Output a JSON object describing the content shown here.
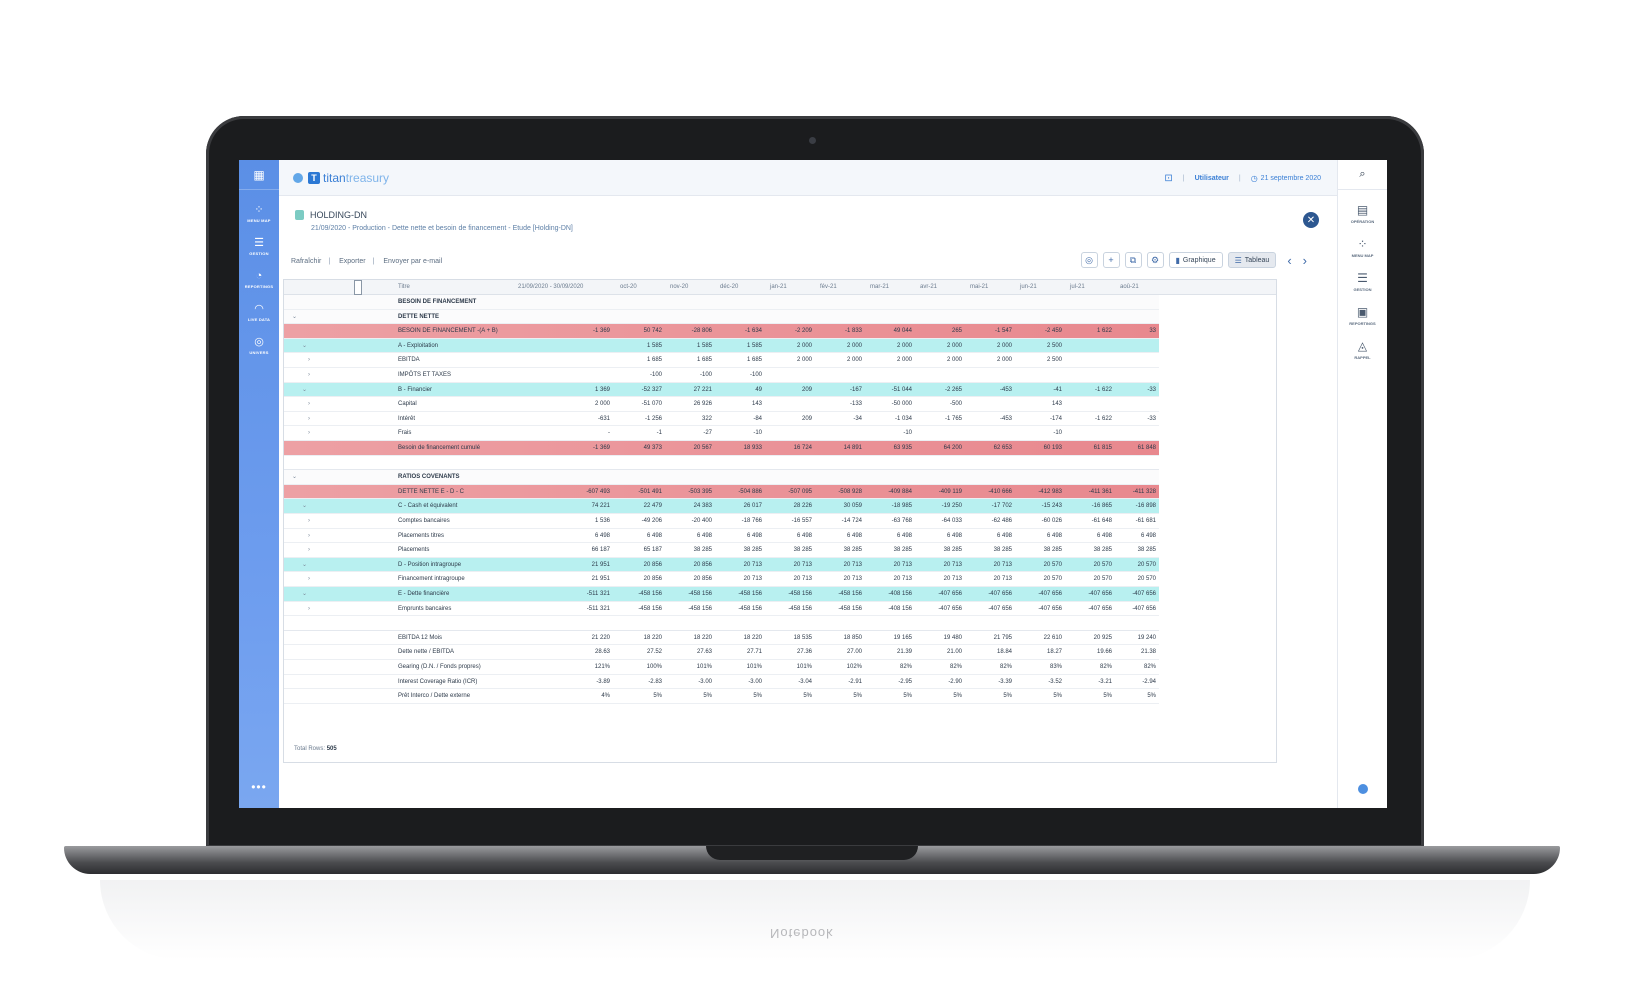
{
  "device_reflection_text": "Notebook",
  "left_sidebar": {
    "top_icon": "calendar-icon",
    "items": [
      {
        "label": "MENU MAP",
        "icon": "grid-icon"
      },
      {
        "label": "GESTION",
        "icon": "list-icon"
      },
      {
        "label": "REPORTINGS",
        "icon": "gauge-icon"
      },
      {
        "label": "LIVE DATA",
        "icon": "rss-icon"
      },
      {
        "label": "UNIVERS",
        "icon": "globe-icon"
      }
    ],
    "more": "•••"
  },
  "header": {
    "logo_word1": "titan",
    "logo_word2": "treasury",
    "user": "Utilisateur",
    "date": "21 septembre 2020"
  },
  "right_sidebar": {
    "items": [
      {
        "label": "OPÉRATION",
        "icon": "document-plus-icon"
      },
      {
        "label": "MENU MAP",
        "icon": "grid-plus-icon"
      },
      {
        "label": "GESTION",
        "icon": "list-plus-icon"
      },
      {
        "label": "REPORTINGS",
        "icon": "report-plus-icon"
      },
      {
        "label": "RAPPEL",
        "icon": "bell-plus-icon"
      }
    ]
  },
  "page": {
    "title": "HOLDING-DN",
    "subtitle": "21/09/2020 - Production - Dette nette et besoin de financement - Etude [Holding-DN]",
    "actions": [
      "Rafraîchir",
      "Exporter",
      "Envoyer par e-mail"
    ],
    "btn_graphique": "Graphique",
    "btn_tableau": "Tableau"
  },
  "table": {
    "columns": [
      "Titre",
      "21/09/2020 - 30/09/2020",
      "oct-20",
      "nov-20",
      "déc-20",
      "jan-21",
      "fév-21",
      "mar-21",
      "avr-21",
      "mai-21",
      "jun-21",
      "jul-21",
      "aoû-21"
    ],
    "rows": [
      {
        "type": "hdrow",
        "caret": "",
        "indent": 0,
        "label": "BESOIN DE FINANCEMENT",
        "values": []
      },
      {
        "type": "hdrow",
        "caret": "v",
        "indent": 0,
        "label": "DETTE NETTE",
        "values": []
      },
      {
        "type": "red",
        "caret": "",
        "indent": 0,
        "label": "BESOIN DE FINANCEMENT -(A + B)",
        "values": [
          "-1 369",
          "50 742",
          "-28 806",
          "-1 634",
          "-2 209",
          "-1 833",
          "49 044",
          "265",
          "-1 547",
          "-2 459",
          "1 622",
          "33"
        ]
      },
      {
        "type": "teal",
        "caret": "v",
        "indent": 1,
        "label": "A - Exploitation",
        "values": [
          "",
          "1 585",
          "1 585",
          "1 585",
          "2 000",
          "2 000",
          "2 000",
          "2 000",
          "2 000",
          "2 500",
          "",
          ""
        ]
      },
      {
        "type": "plain",
        "caret": ">",
        "indent": 2,
        "label": "EBITDA",
        "values": [
          "",
          "1 685",
          "1 685",
          "1 685",
          "2 000",
          "2 000",
          "2 000",
          "2 000",
          "2 000",
          "2 500",
          "",
          ""
        ]
      },
      {
        "type": "plain",
        "caret": ">",
        "indent": 2,
        "label": "IMPÔTS ET TAXES",
        "values": [
          "",
          "-100",
          "-100",
          "-100",
          "",
          "",
          "",
          "",
          "",
          "",
          "",
          ""
        ]
      },
      {
        "type": "teal",
        "caret": "v",
        "indent": 1,
        "label": "B - Financier",
        "values": [
          "1 369",
          "-52 327",
          "27 221",
          "49",
          "209",
          "-167",
          "-51 044",
          "-2 265",
          "-453",
          "-41",
          "-1 622",
          "-33"
        ]
      },
      {
        "type": "plain",
        "caret": ">",
        "indent": 2,
        "label": "Capital",
        "values": [
          "2 000",
          "-51 070",
          "26 926",
          "143",
          "",
          "-133",
          "-50 000",
          "-500",
          "",
          "143",
          "",
          ""
        ]
      },
      {
        "type": "plain",
        "caret": ">",
        "indent": 2,
        "label": "Intérêt",
        "values": [
          "-631",
          "-1 256",
          "322",
          "-84",
          "209",
          "-34",
          "-1 034",
          "-1 765",
          "-453",
          "-174",
          "-1 622",
          "-33"
        ]
      },
      {
        "type": "plain",
        "caret": ">",
        "indent": 2,
        "label": "Frais",
        "values": [
          "-",
          "-1",
          "-27",
          "-10",
          "",
          "",
          "-10",
          "",
          "",
          "-10",
          "",
          ""
        ]
      },
      {
        "type": "red",
        "caret": "",
        "indent": 0,
        "label": "Besoin de financement cumulé",
        "values": [
          "-1 369",
          "49 373",
          "20 567",
          "18 933",
          "16 724",
          "14 891",
          "63 935",
          "64 200",
          "62 653",
          "60 193",
          "61 815",
          "61 848"
        ]
      },
      {
        "type": "sepw",
        "caret": "",
        "indent": 0,
        "label": "",
        "values": []
      },
      {
        "type": "hdrow",
        "caret": "v",
        "indent": 0,
        "label": "RATIOS COVENANTS",
        "values": []
      },
      {
        "type": "red",
        "caret": "",
        "indent": 0,
        "label": "DETTE NETTE E - D - C",
        "values": [
          "-607 493",
          "-501 491",
          "-503 395",
          "-504 886",
          "-507 095",
          "-508 928",
          "-409 884",
          "-409 119",
          "-410 666",
          "-412 983",
          "-411 361",
          "-411 328"
        ]
      },
      {
        "type": "teal",
        "caret": "v",
        "indent": 1,
        "label": "C - Cash et équivalent",
        "values": [
          "74 221",
          "22 479",
          "24 383",
          "26 017",
          "28 226",
          "30 059",
          "-18 985",
          "-19 250",
          "-17 702",
          "-15 243",
          "-16 865",
          "-16 898"
        ]
      },
      {
        "type": "plain",
        "caret": ">",
        "indent": 2,
        "label": "Comptes bancaires",
        "values": [
          "1 536",
          "-49 206",
          "-20 400",
          "-18 766",
          "-16 557",
          "-14 724",
          "-63 768",
          "-64 033",
          "-62 486",
          "-60 026",
          "-61 648",
          "-61 681"
        ]
      },
      {
        "type": "plain",
        "caret": ">",
        "indent": 2,
        "label": "Placements titres",
        "values": [
          "6 498",
          "6 498",
          "6 498",
          "6 498",
          "6 498",
          "6 498",
          "6 498",
          "6 498",
          "6 498",
          "6 498",
          "6 498",
          "6 498"
        ]
      },
      {
        "type": "plain",
        "caret": ">",
        "indent": 2,
        "label": "Placements",
        "values": [
          "66 187",
          "65 187",
          "38 285",
          "38 285",
          "38 285",
          "38 285",
          "38 285",
          "38 285",
          "38 285",
          "38 285",
          "38 285",
          "38 285"
        ]
      },
      {
        "type": "teal",
        "caret": "v",
        "indent": 1,
        "label": "D - Position intragroupe",
        "values": [
          "21 951",
          "20 856",
          "20 856",
          "20 713",
          "20 713",
          "20 713",
          "20 713",
          "20 713",
          "20 713",
          "20 570",
          "20 570",
          "20 570"
        ]
      },
      {
        "type": "plain",
        "caret": ">",
        "indent": 2,
        "label": "Financement intragroupe",
        "values": [
          "21 951",
          "20 856",
          "20 856",
          "20 713",
          "20 713",
          "20 713",
          "20 713",
          "20 713",
          "20 713",
          "20 570",
          "20 570",
          "20 570"
        ]
      },
      {
        "type": "teal",
        "caret": "v",
        "indent": 1,
        "label": "E - Dette financière",
        "values": [
          "-511 321",
          "-458 156",
          "-458 156",
          "-458 156",
          "-458 156",
          "-458 156",
          "-408 156",
          "-407 656",
          "-407 656",
          "-407 656",
          "-407 656",
          "-407 656"
        ]
      },
      {
        "type": "plain",
        "caret": ">",
        "indent": 2,
        "label": "Emprunts bancaires",
        "values": [
          "-511 321",
          "-458 156",
          "-458 156",
          "-458 156",
          "-458 156",
          "-458 156",
          "-408 156",
          "-407 656",
          "-407 656",
          "-407 656",
          "-407 656",
          "-407 656"
        ]
      },
      {
        "type": "sepw",
        "caret": "",
        "indent": 0,
        "label": "",
        "values": []
      },
      {
        "type": "plain",
        "caret": "",
        "indent": 0,
        "label": "EBITDA 12 Mois",
        "values": [
          "21 220",
          "18 220",
          "18 220",
          "18 220",
          "18 535",
          "18 850",
          "19 165",
          "19 480",
          "21 795",
          "22 610",
          "20 925",
          "19 240"
        ]
      },
      {
        "type": "plain",
        "caret": "",
        "indent": 0,
        "label": "Dette nette / EBITDA",
        "values": [
          "28.63",
          "27.52",
          "27.63",
          "27.71",
          "27.36",
          "27.00",
          "21.39",
          "21.00",
          "18.84",
          "18.27",
          "19.66",
          "21.38"
        ]
      },
      {
        "type": "plain",
        "caret": "",
        "indent": 0,
        "label": "Gearing (D.N. / Fonds propres)",
        "values": [
          "121%",
          "100%",
          "101%",
          "101%",
          "101%",
          "102%",
          "82%",
          "82%",
          "82%",
          "83%",
          "82%",
          "82%"
        ]
      },
      {
        "type": "plain",
        "caret": "",
        "indent": 0,
        "label": "Interest Coverage Ratio (ICR)",
        "values": [
          "-3.89",
          "-2.83",
          "-3.00",
          "-3.00",
          "-3.04",
          "-2.91",
          "-2.95",
          "-2.90",
          "-3.39",
          "-3.52",
          "-3.21",
          "-2.94"
        ]
      },
      {
        "type": "plain",
        "caret": "",
        "indent": 0,
        "label": "Prêt Interco / Dette externe",
        "values": [
          "4%",
          "5%",
          "5%",
          "5%",
          "5%",
          "5%",
          "5%",
          "5%",
          "5%",
          "5%",
          "5%",
          "5%"
        ]
      }
    ],
    "total_rows_label": "Total Rows:",
    "total_rows_value": "505"
  }
}
